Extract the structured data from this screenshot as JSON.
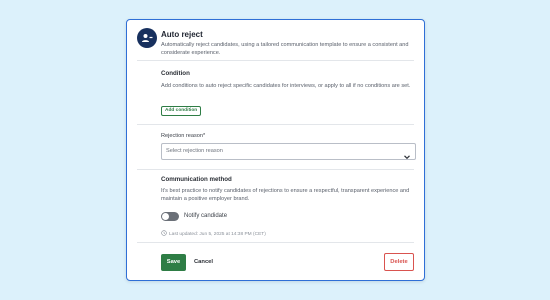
{
  "dialog": {
    "title": "Auto reject",
    "subtitle": "Automatically reject candidates, using a tailored communication template to ensure a consistent and considerate experience.",
    "icon": "reject-person-icon"
  },
  "condition": {
    "label": "Condition",
    "help": "Add conditions to auto reject specific candidates for interviews, or apply to all if no conditions are set.",
    "add_button": "Add condition"
  },
  "rejection": {
    "label": "Rejection reason*",
    "placeholder": "Select rejection reason"
  },
  "communication": {
    "label": "Communication method",
    "help": "It's best practice to notify candidates of rejections to ensure a respectful, transparent experience and maintain a positive employer brand.",
    "toggle_label": "Notify candidate",
    "toggle_on": false,
    "last_updated": "Last updated: Jun 5, 2025 at 14:38 PM (CET)"
  },
  "actions": {
    "save": "Save",
    "cancel": "Cancel",
    "delete": "Delete"
  },
  "colors": {
    "background": "#dcf1fb",
    "accent_border": "#2f6fd6",
    "primary_green": "#2e7d45",
    "danger_red": "#d9534f",
    "avatar_navy": "#17305e"
  }
}
